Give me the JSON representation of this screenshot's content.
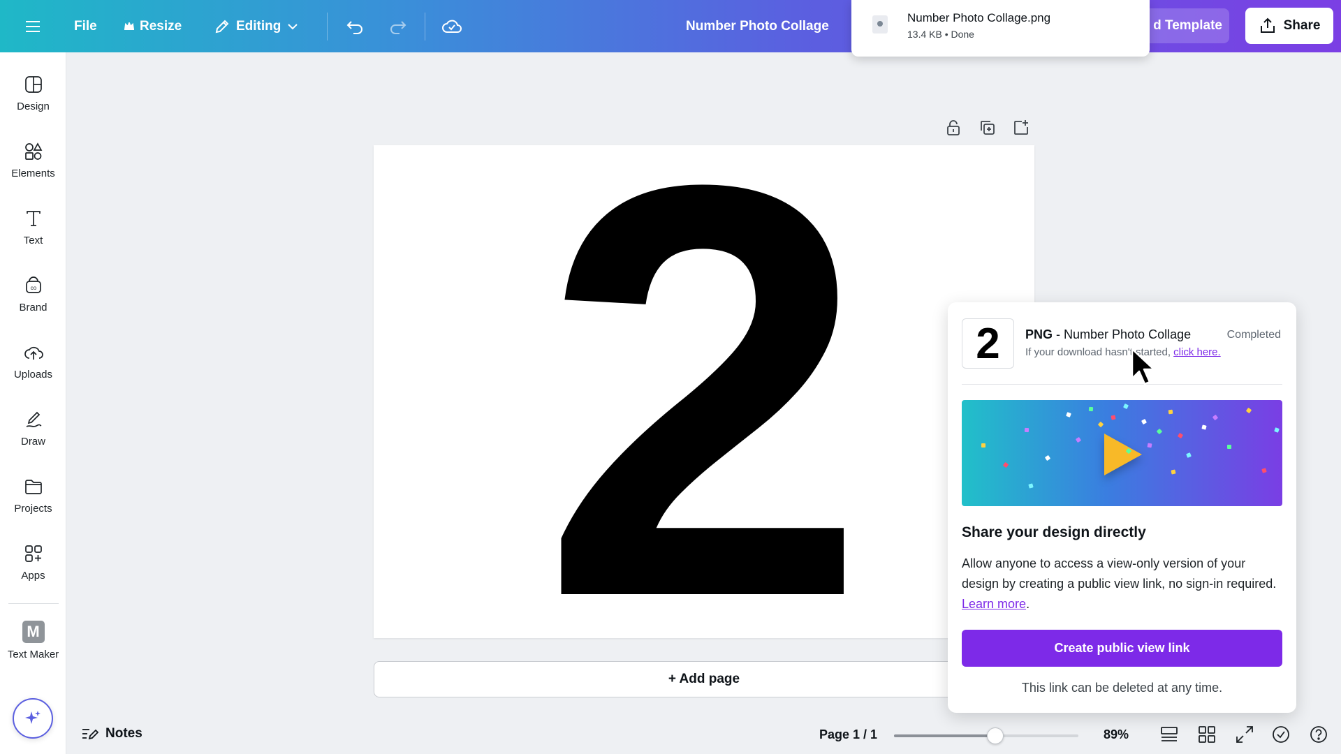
{
  "topbar": {
    "menu_icon": "hamburger-icon",
    "file_label": "File",
    "resize_label": "Resize",
    "editing_label": "Editing",
    "doc_title": "Number Photo Collage",
    "template_label": "d Template",
    "share_label": "Share"
  },
  "toast": {
    "file_name": "Number Photo Collage.png",
    "meta": "13.4 KB • Done"
  },
  "sidebar": {
    "items": [
      {
        "label": "Design",
        "icon": "design-icon"
      },
      {
        "label": "Elements",
        "icon": "elements-icon"
      },
      {
        "label": "Text",
        "icon": "text-icon"
      },
      {
        "label": "Brand",
        "icon": "brand-icon"
      },
      {
        "label": "Uploads",
        "icon": "upload-cloud-icon"
      },
      {
        "label": "Draw",
        "icon": "draw-icon"
      },
      {
        "label": "Projects",
        "icon": "folder-icon"
      },
      {
        "label": "Apps",
        "icon": "apps-icon"
      },
      {
        "label": "Text Maker",
        "icon": "text-maker-icon"
      }
    ],
    "text_maker_glyph": "M"
  },
  "canvas": {
    "number": "2",
    "add_page_label": "+ Add page"
  },
  "bottombar": {
    "notes_label": "Notes",
    "page_indicator": "Page 1 / 1",
    "zoom_fraction": 0.55,
    "zoom_label": "89%"
  },
  "panel": {
    "thumb_number": "2",
    "format": "PNG",
    "title_rest": " - Number Photo Collage",
    "status": "Completed",
    "sub_text": "If your download hasn't started, ",
    "sub_link": "click here.",
    "share_heading": "Share your design directly",
    "share_body": "Allow anyone to access a view-only version of your design by creating a public view link, no sign-in required. ",
    "learn_more": "Learn more",
    "cta_label": "Create public view link",
    "foot_note": "This link can be deleted at any time."
  },
  "colors": {
    "accent": "#7d2ae8",
    "gradient_start": "#1fb8c7",
    "gradient_end": "#7b3fe4"
  }
}
